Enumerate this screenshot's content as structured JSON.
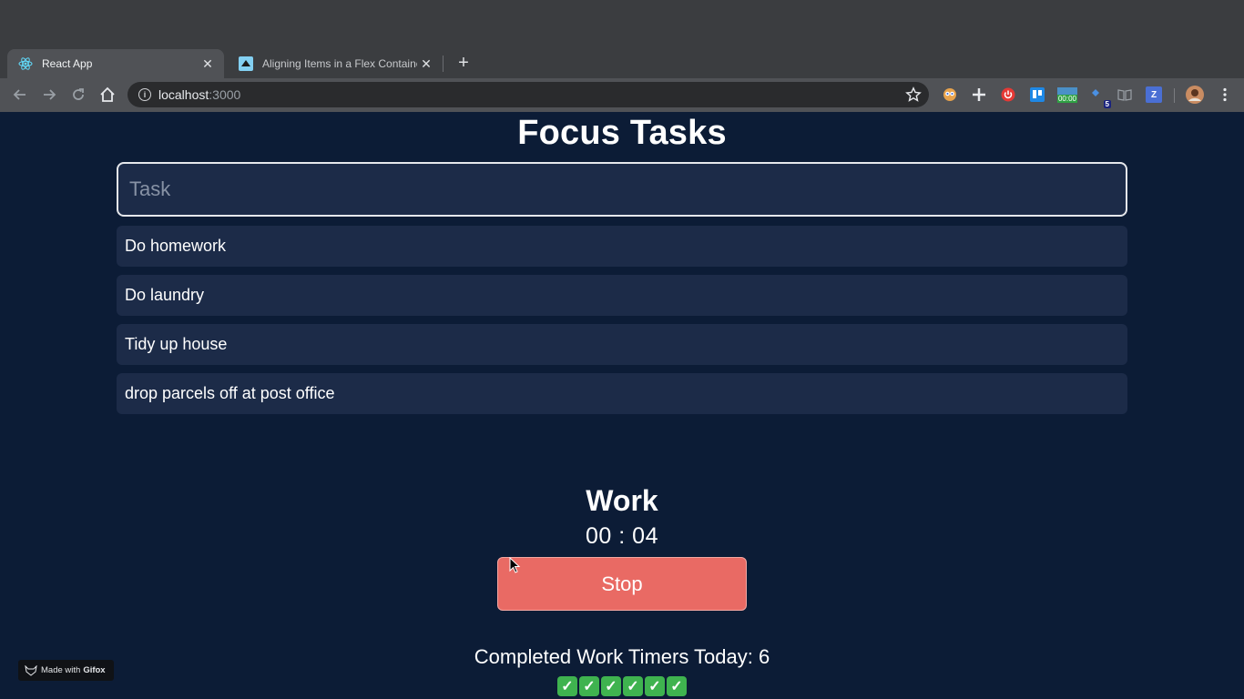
{
  "browser": {
    "tabs": [
      {
        "title": "React App",
        "active": true,
        "icon": "react-icon"
      },
      {
        "title": "Aligning Items in a Flex Containe",
        "active": false,
        "icon": "mdn-icon"
      }
    ],
    "close_glyph": "✕",
    "newtab_glyph": "+",
    "url_host": "localhost",
    "url_port": ":3000",
    "extension_badges": {
      "timer": "00:00",
      "count": "5",
      "z": "Z"
    }
  },
  "app": {
    "title": "Focus Tasks",
    "task_placeholder": "Task",
    "tasks": [
      "Do homework",
      "Do laundry",
      "Tidy up house",
      "drop parcels off at post office"
    ],
    "mode": "Work",
    "timer": "00 : 04",
    "stop_label": "Stop",
    "completed_label": "Completed Work Timers Today: 6",
    "completed_count": 6,
    "check_glyph": "✓",
    "colors": {
      "background": "#0c1c36",
      "card": "#1c2b48",
      "stop": "#e96a64",
      "check": "#3fb34f"
    }
  },
  "watermark": {
    "prefix": "Made with",
    "brand": "Gifox"
  }
}
